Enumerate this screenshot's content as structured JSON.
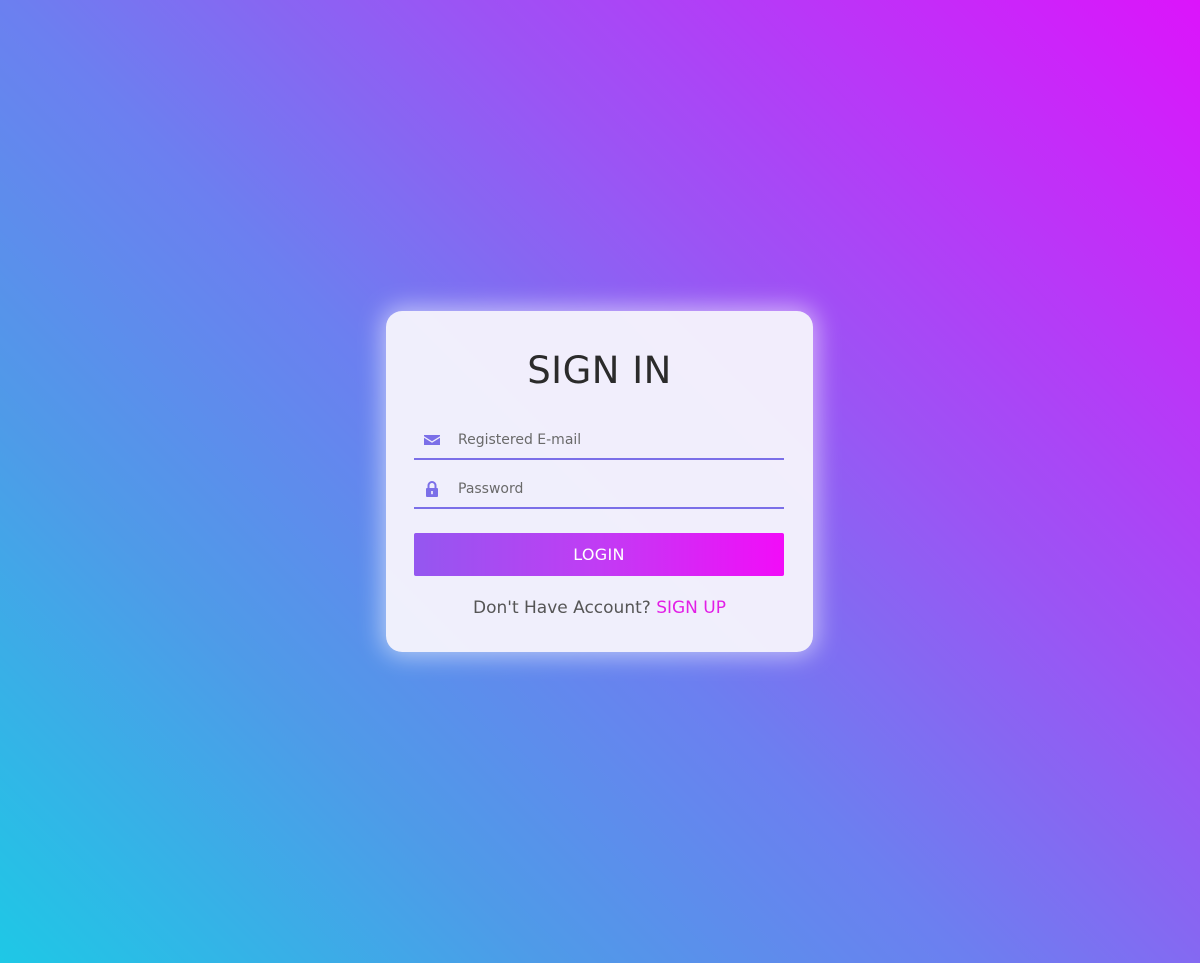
{
  "signin": {
    "title": "SIGN IN",
    "email": {
      "placeholder": "Registered E-mail",
      "value": "",
      "icon": "envelope-icon"
    },
    "password": {
      "placeholder": "Password",
      "value": "",
      "icon": "lock-icon"
    },
    "login_label": "LOGIN",
    "footer": {
      "prompt": "Don't Have Account?",
      "link_label": "SIGN UP"
    }
  },
  "colors": {
    "accent": "#7b6fe8",
    "link": "#e21fe6",
    "button_start": "#9457f0",
    "button_end": "#f20cf8",
    "background_start": "#1ec8e6",
    "background_end": "#dc14fb"
  }
}
